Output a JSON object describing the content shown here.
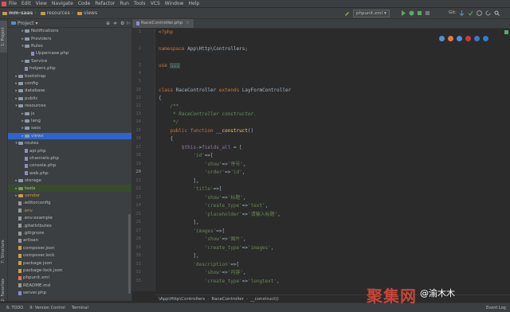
{
  "menubar": {
    "items": [
      "File",
      "Edit",
      "View",
      "Navigate",
      "Code",
      "Refactor",
      "Run",
      "Tools",
      "VCS",
      "Window",
      "Help"
    ]
  },
  "navbar": {
    "crumbs": [
      "mm-saas",
      "resources",
      "views"
    ],
    "run_config": "phpunit.xml",
    "git_label": "Git:"
  },
  "left_strip": {
    "project_tab": "1: Project",
    "structure_tab": "7: Structure",
    "favorites_tab": "2: Favorites"
  },
  "project": {
    "header": "Project",
    "tree": [
      {
        "label": "Notifications",
        "type": "folder",
        "indent": 4,
        "arrow": "▸"
      },
      {
        "label": "Providers",
        "type": "folder",
        "indent": 4,
        "arrow": "▸"
      },
      {
        "label": "Rules",
        "type": "folder",
        "indent": 4,
        "arrow": "▾"
      },
      {
        "label": "Uppercase.php",
        "type": "php",
        "indent": 6,
        "arrow": ""
      },
      {
        "label": "Service",
        "type": "folder",
        "indent": 4,
        "arrow": "▸"
      },
      {
        "label": "helpers.php",
        "type": "php",
        "indent": 4,
        "arrow": ""
      },
      {
        "label": "bootstrap",
        "type": "folder",
        "indent": 2,
        "arrow": "▸"
      },
      {
        "label": "config",
        "type": "folder",
        "indent": 2,
        "arrow": "▸"
      },
      {
        "label": "database",
        "type": "folder",
        "indent": 2,
        "arrow": "▸"
      },
      {
        "label": "public",
        "type": "folder",
        "indent": 2,
        "arrow": "▸"
      },
      {
        "label": "resources",
        "type": "folder",
        "indent": 2,
        "arrow": "▾"
      },
      {
        "label": "js",
        "type": "folder",
        "indent": 4,
        "arrow": "▸"
      },
      {
        "label": "lang",
        "type": "folder",
        "indent": 4,
        "arrow": "▸"
      },
      {
        "label": "sass",
        "type": "folder",
        "indent": 4,
        "arrow": "▸"
      },
      {
        "label": "views",
        "type": "folder",
        "indent": 4,
        "arrow": "▸",
        "selected": true
      },
      {
        "label": "routes",
        "type": "folder",
        "indent": 2,
        "arrow": "▾"
      },
      {
        "label": "api.php",
        "type": "php",
        "indent": 4,
        "arrow": ""
      },
      {
        "label": "channels.php",
        "type": "php",
        "indent": 4,
        "arrow": ""
      },
      {
        "label": "console.php",
        "type": "php",
        "indent": 4,
        "arrow": ""
      },
      {
        "label": "web.php",
        "type": "php",
        "indent": 4,
        "arrow": ""
      },
      {
        "label": "storage",
        "type": "folder",
        "indent": 2,
        "arrow": "▸"
      },
      {
        "label": "tests",
        "type": "folder-green",
        "indent": 2,
        "arrow": "▸",
        "highlight": true
      },
      {
        "label": "vendor",
        "type": "folder-yellow",
        "indent": 2,
        "arrow": "▸",
        "muted": true
      },
      {
        "label": ".editorconfig",
        "type": "txt",
        "indent": 2,
        "arrow": ""
      },
      {
        "label": ".env",
        "type": "txt",
        "indent": 2,
        "arrow": "",
        "muted": true
      },
      {
        "label": ".env.example",
        "type": "txt",
        "indent": 2,
        "arrow": ""
      },
      {
        "label": ".gitattributes",
        "type": "txt",
        "indent": 2,
        "arrow": ""
      },
      {
        "label": ".gitignore",
        "type": "txt",
        "indent": 2,
        "arrow": ""
      },
      {
        "label": "artisan",
        "type": "txt",
        "indent": 2,
        "arrow": ""
      },
      {
        "label": "composer.json",
        "type": "json",
        "indent": 2,
        "arrow": ""
      },
      {
        "label": "composer.lock",
        "type": "json",
        "indent": 2,
        "arrow": ""
      },
      {
        "label": "package.json",
        "type": "json",
        "indent": 2,
        "arrow": ""
      },
      {
        "label": "package-lock.json",
        "type": "json",
        "indent": 2,
        "arrow": ""
      },
      {
        "label": "phpunit.xml",
        "type": "xml",
        "indent": 2,
        "arrow": ""
      },
      {
        "label": "README.md",
        "type": "txt",
        "indent": 2,
        "arrow": ""
      },
      {
        "label": "server.php",
        "type": "php",
        "indent": 2,
        "arrow": ""
      }
    ]
  },
  "editor": {
    "tab_label": "RaceController.php",
    "line_numbers": [
      "1",
      "2",
      "3",
      "4",
      "5",
      "10",
      "11",
      "12",
      "13",
      "14",
      "15",
      "16",
      "17",
      "18",
      "19",
      "20",
      "21",
      "22",
      "23",
      "24",
      "25",
      "26",
      "27",
      "28",
      "29",
      "30",
      "31",
      "32",
      "33"
    ],
    "current_line": "20"
  },
  "breadcrumb": {
    "path": "\\App\\Http\\Controllers",
    "cls": "RaceController",
    "method": "__construct()"
  },
  "statusbar": {
    "todo": "6: TODO",
    "vcs": "9: Version Control",
    "terminal": "Terminal",
    "event_log": "Event Log"
  },
  "watermark": {
    "main": "聚集网",
    "account": "渝木木"
  },
  "colors": {
    "background": "#2b2b2b",
    "panel": "#3c3f41",
    "keyword": "#cc7832",
    "string": "#6a8759",
    "variable": "#9876aa",
    "selection": "#0d293e"
  }
}
